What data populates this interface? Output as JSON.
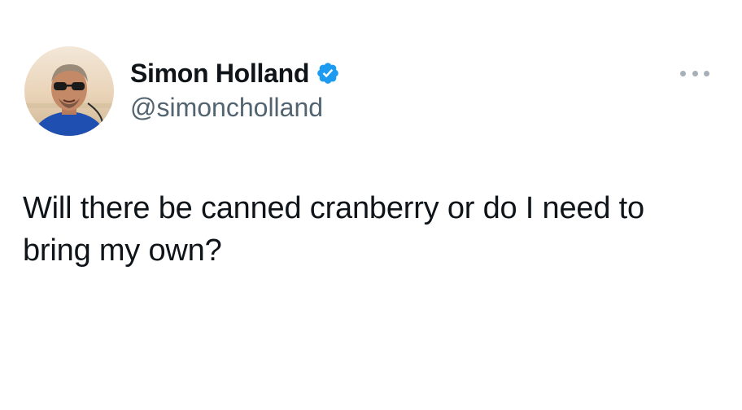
{
  "author": {
    "display_name": "Simon Holland",
    "handle": "@simoncholland",
    "verified": true,
    "avatar_icon": "profile-photo"
  },
  "tweet": {
    "text": "Will there be canned cranberry or do I need to bring my own?"
  },
  "colors": {
    "text_primary": "#0f1419",
    "text_secondary": "#536471",
    "verified_blue": "#1d9bf0",
    "background": "#ffffff"
  },
  "icons": {
    "verified": "verified-badge-icon",
    "more": "more-options-icon"
  }
}
